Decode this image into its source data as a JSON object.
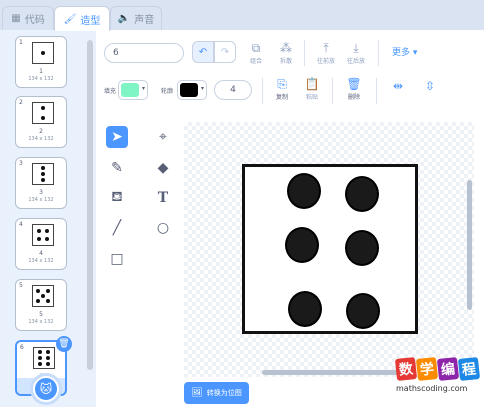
{
  "tabs": [
    {
      "label": "代码",
      "icon": "code-icon"
    },
    {
      "label": "造型",
      "icon": "costume-brush-icon"
    },
    {
      "label": "声音",
      "icon": "sound-icon"
    }
  ],
  "costumes": [
    {
      "num": "1",
      "name": "1",
      "size": "134 x 132"
    },
    {
      "num": "2",
      "name": "2",
      "size": "134 x 132"
    },
    {
      "num": "3",
      "name": "3",
      "size": "134 x 132"
    },
    {
      "num": "4",
      "name": "4",
      "size": "134 x 132"
    },
    {
      "num": "5",
      "name": "5",
      "size": "134 x 132"
    },
    {
      "num": "6",
      "name": "6",
      "size": "",
      "selected": true
    }
  ],
  "editor": {
    "costume_name": "6",
    "tools": {
      "group": "组合",
      "ungroup": "拆散",
      "forward": "往前放",
      "backward": "往后放",
      "more": "更多",
      "copy": "复制",
      "paste": "粘贴",
      "delete": "删除"
    },
    "fill_label": "填充",
    "fill_color": "#7ff5c5",
    "outline_label": "轮廓",
    "outline_color": "#000000",
    "outline_width": "4",
    "convert_label": "转换为位图"
  },
  "watermark": {
    "chars": [
      "数",
      "学",
      "编",
      "程"
    ],
    "colors": [
      "#e53935",
      "#fb8c00",
      "#8e24aa",
      "#1e88e5"
    ],
    "url": "mathscoding.com"
  }
}
